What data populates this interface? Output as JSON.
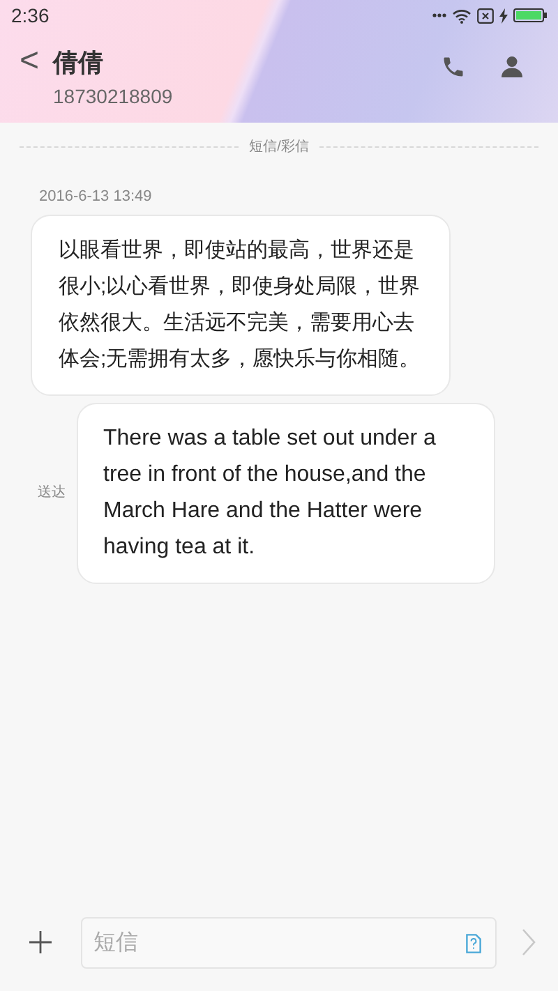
{
  "status_bar": {
    "time": "2:36"
  },
  "header": {
    "back": "<",
    "name": "倩倩",
    "number": "18730218809"
  },
  "channel_label": "短信/彩信",
  "messages": [
    {
      "kind": "incoming",
      "time": "2016-6-13 13:49",
      "text": "以眼看世界，即使站的最高，世界还是很小;以心看世界，即使身处局限，世界依然很大。生活远不完美，需要用心去体会;无需拥有太多，愿快乐与你相随。"
    },
    {
      "kind": "outgoing",
      "status": "送达",
      "text": "There was a table set out under a tree in front of the house,and the March Hare and the Hatter were having tea at it."
    }
  ],
  "composer": {
    "placeholder": "短信",
    "send_disabled": true
  }
}
